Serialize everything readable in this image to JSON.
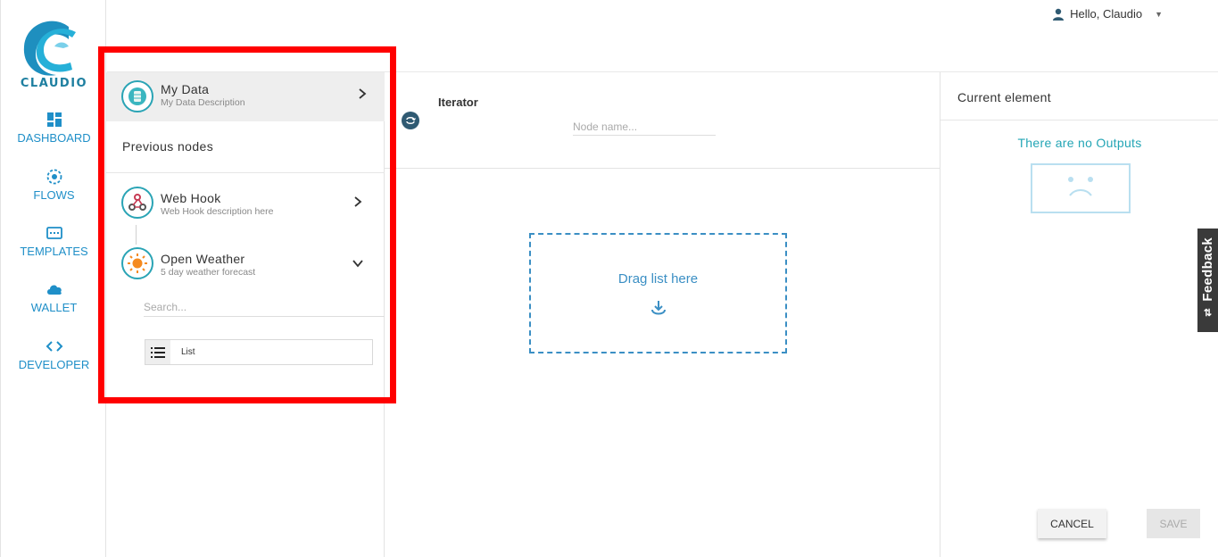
{
  "brand": {
    "name": "CLAUDIO",
    "color": "#1e7fa0"
  },
  "nav": [
    {
      "label": "DASHBOARD",
      "icon": "dashboard-icon"
    },
    {
      "label": "FLOWS",
      "icon": "flows-icon"
    },
    {
      "label": "TEMPLATES",
      "icon": "templates-icon"
    },
    {
      "label": "WALLET",
      "icon": "cloud-icon"
    },
    {
      "label": "DEVELOPER",
      "icon": "code-icon"
    }
  ],
  "user": {
    "greeting": "Hello, Claudio"
  },
  "nodes": {
    "my_data": {
      "title": "My Data",
      "description": "My Data Description",
      "icon": "database-icon"
    },
    "previous_title": "Previous nodes",
    "items": [
      {
        "title": "Web Hook",
        "description": "Web Hook description here",
        "icon": "webhook-icon",
        "chevron": "right"
      },
      {
        "title": "Open Weather",
        "description": "5 day weather forecast",
        "icon": "sun-icon",
        "chevron": "down"
      }
    ],
    "search_placeholder": "Search...",
    "list_item": {
      "label": "List",
      "icon": "list-icon"
    }
  },
  "center": {
    "title": "Iterator",
    "node_name_placeholder": "Node name...",
    "dropzone_text": "Drag list here"
  },
  "right": {
    "title": "Current element",
    "no_outputs": "There are no Outputs",
    "cancel_label": "CANCEL",
    "save_label": "SAVE"
  },
  "feedback": {
    "label": "Feedback"
  },
  "colors": {
    "accent": "#1f8fc8",
    "teal": "#23a5b5",
    "highlight": "#ff0000"
  }
}
